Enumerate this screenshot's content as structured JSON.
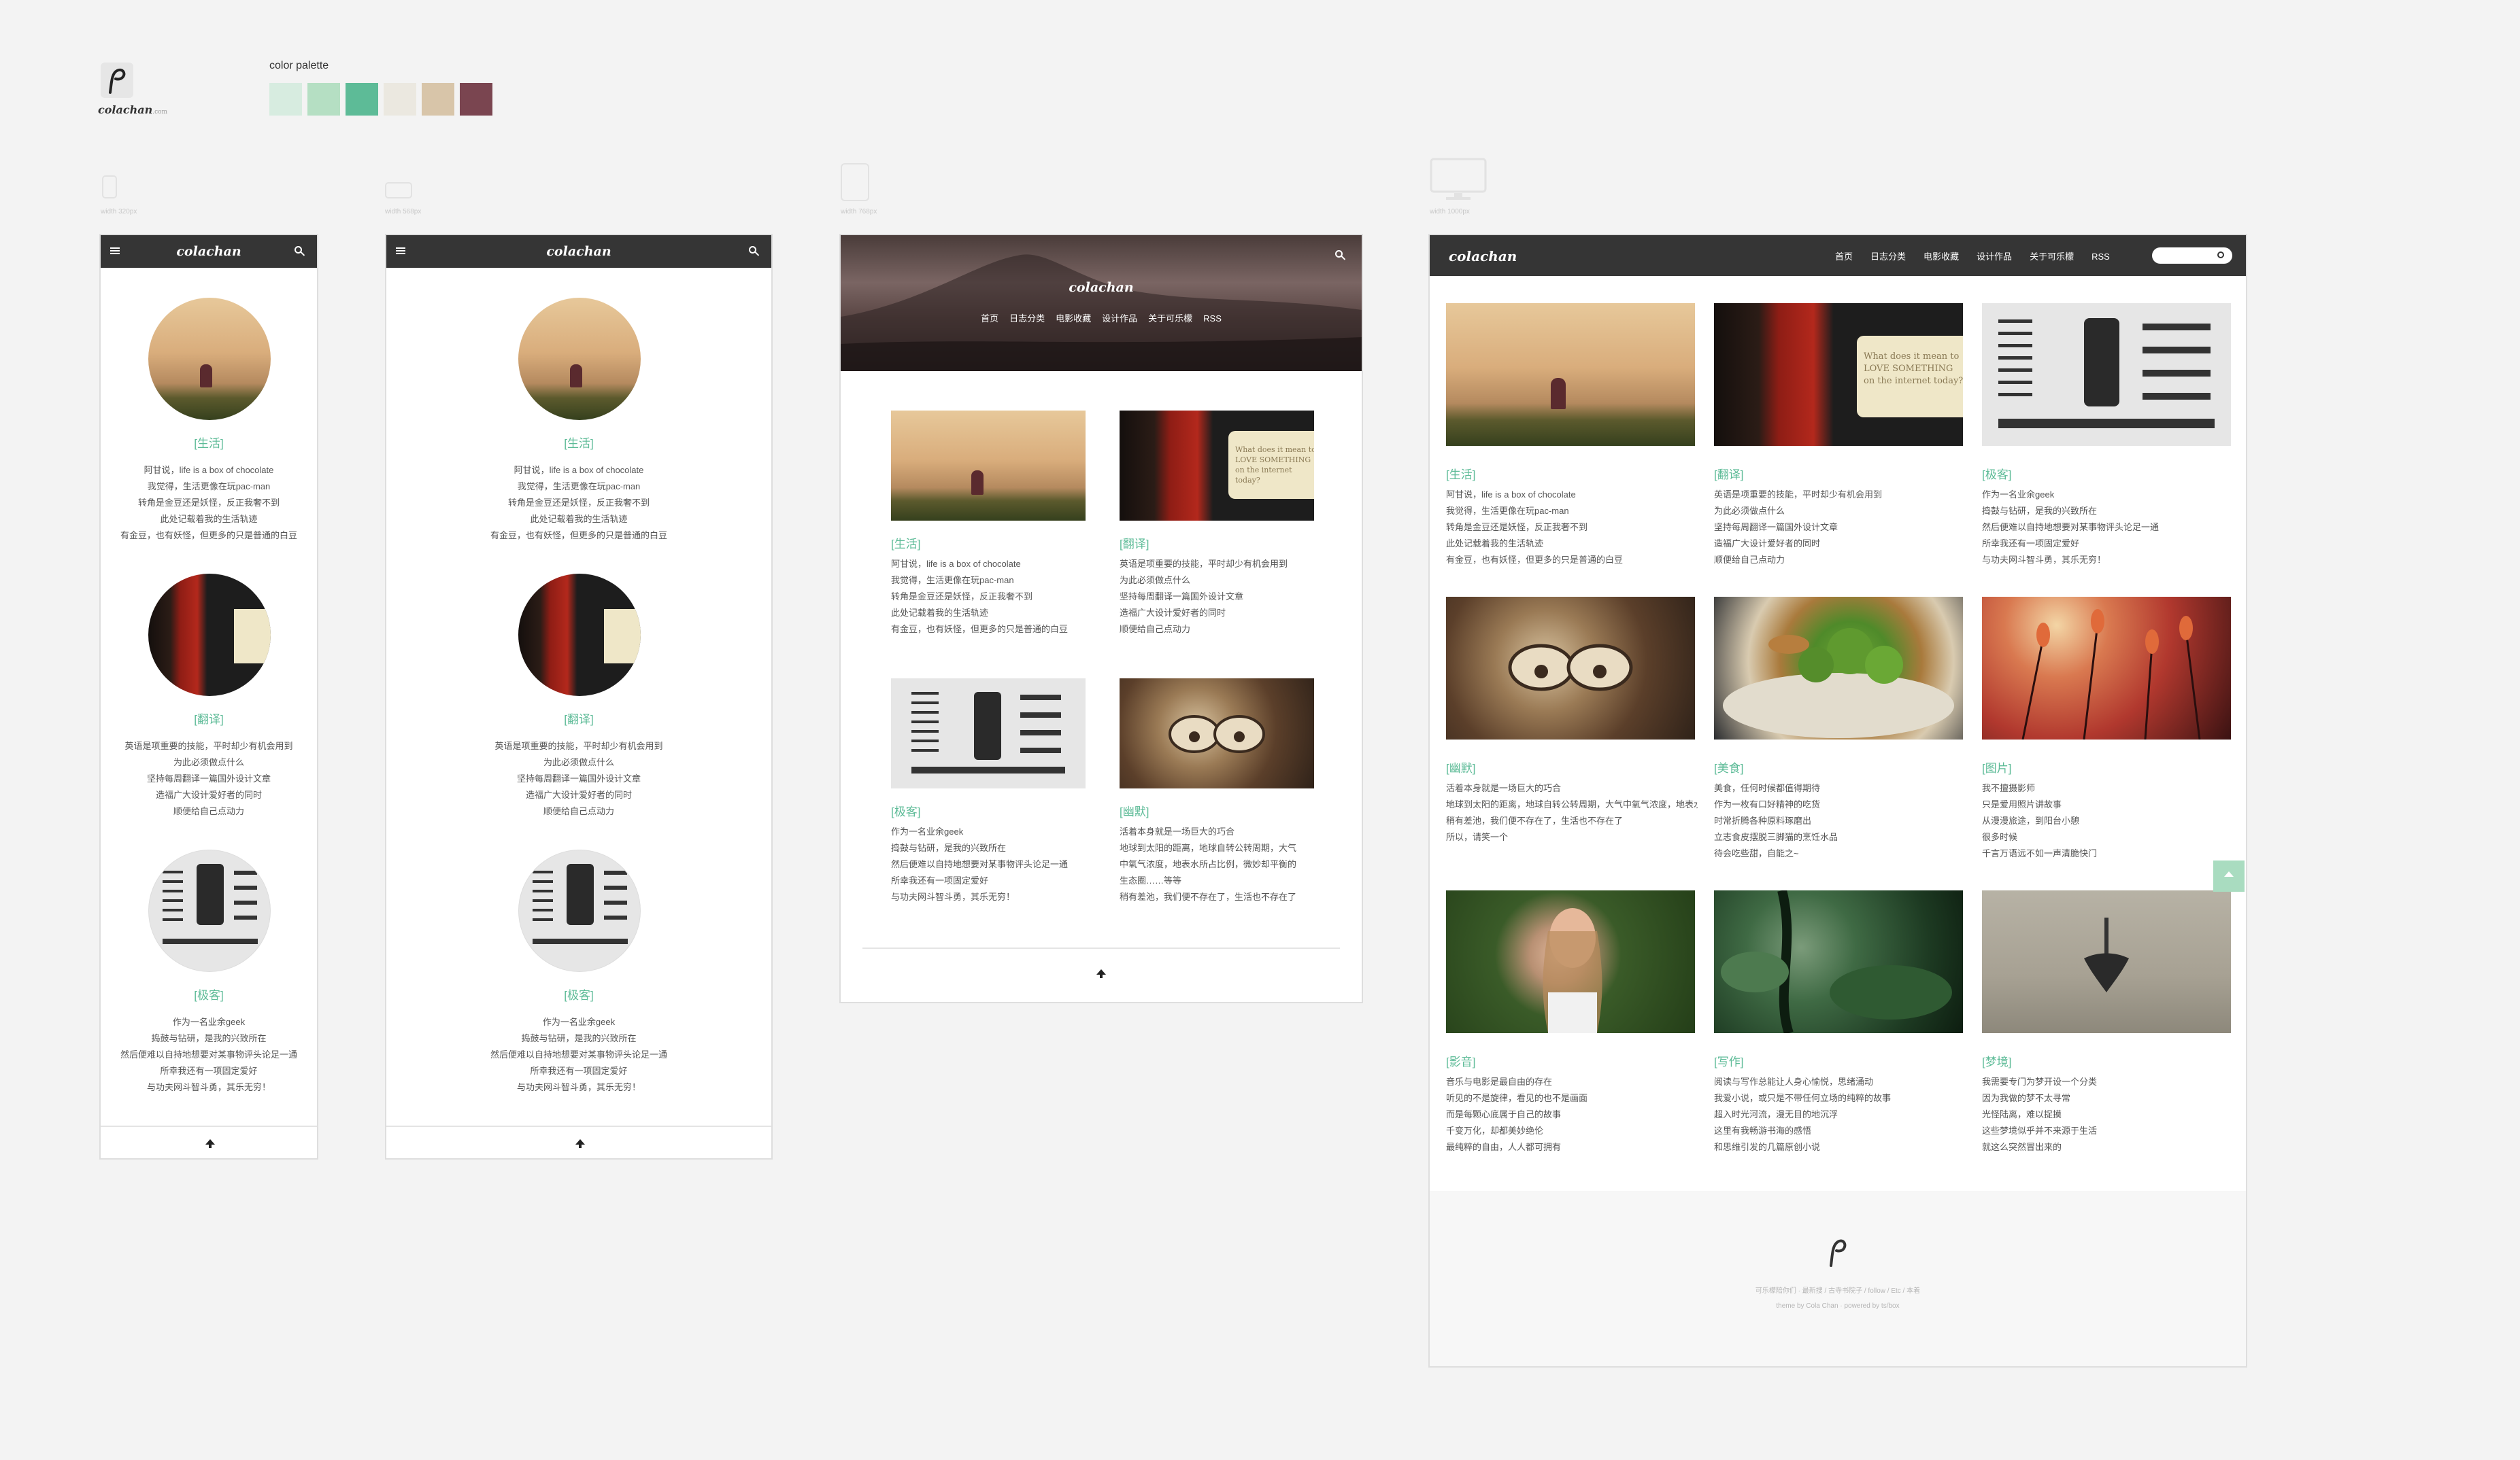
{
  "brand": {
    "name": "colachan",
    "suffix": ".com"
  },
  "palette": {
    "label": "color palette",
    "colors": [
      "#d7ece0",
      "#b5dfc3",
      "#5dbb97",
      "#ebe8e0",
      "#d8c5a9",
      "#7a4550"
    ]
  },
  "devices": [
    {
      "icon": "phone-icon",
      "label": "width 320px"
    },
    {
      "icon": "phone-landscape-icon",
      "label": "width 568px"
    },
    {
      "icon": "tablet-icon",
      "label": "width 768px"
    },
    {
      "icon": "desktop-icon",
      "label": "width 1000px"
    }
  ],
  "site": {
    "logo": "colachan",
    "nav": [
      "首页",
      "日志分类",
      "电影收藏",
      "设计作品",
      "关于可乐檬",
      "RSS"
    ],
    "posts": [
      {
        "category": "[生活]",
        "lines": [
          "阿甘说，life is a box of chocolate",
          "我觉得，生活更像在玩pac-man",
          "转角是金豆还是妖怪，反正我奢不到",
          "此处记载着我的生活轨迹",
          "有金豆，也有妖怪，但更多的只是普通的白豆"
        ]
      },
      {
        "category": "[翻译]",
        "lines": [
          "英语是项重要的技能，平时却少有机会用到",
          "为此必须做点什么",
          "坚持每周翻译一篇国外设计文章",
          "造福广大设计爱好者的同时",
          "顺便给自己点动力"
        ]
      },
      {
        "category": "[极客]",
        "lines": [
          "作为一名业余geek",
          "捣鼓与钻研，是我的兴致所在",
          "然后便难以自持地想要对某事物评头论足一通",
          "所幸我还有一项固定爱好",
          "与功夫网斗智斗勇，其乐无穷！"
        ]
      },
      {
        "category": "[幽默]",
        "lines": [
          "活着本身就是一场巨大的巧合",
          "地球到太阳的距离，地球自转公转周期，大气中氧气浓度，地表水所占比例，微妙却平衡的生态圈……等等",
          "稍有差池，我们便不存在了，生活也不存在了",
          "所以，请笑一个"
        ]
      },
      {
        "category": "[美食]",
        "lines": [
          "美食，任何时候都值得期待",
          "作为一枚有口好精神的吃货",
          "时常折腾各种原料琢磨出",
          "立志食皮摆脱三脚猫的烹饪水品",
          "待会吃些甜，自能之~"
        ]
      },
      {
        "category": "[图片]",
        "lines": [
          "我不擅摄影师",
          "只是爱用照片讲故事",
          "从漫漫旅途，到阳台小憩",
          "很多时候",
          "千言万语远不如一声清脆快门"
        ]
      },
      {
        "category": "[影音]",
        "lines": [
          "音乐与电影是最自由的存在",
          "听见的不是旋律，看见的也不是画面",
          "而是每颗心底属于自己的故事",
          "千变万化，却都美妙绝伦",
          "最纯粹的自由，人人都可拥有"
        ]
      },
      {
        "category": "[写作]",
        "lines": [
          "阅读与写作总能让人身心愉悦，思绪涌动",
          "我爱小说，或只是不带任何立场的纯粹的故事",
          "超入时光河流，漫无目的地沉浮",
          "这里有我畅游书海的感悟",
          "和思维引发的几篇原创小说"
        ]
      },
      {
        "category": "[梦境]",
        "lines": [
          "我需要专门为梦开设一个分类",
          "因为我做的梦不太寻常",
          "光怪陆离，难以捉摸",
          "这些梦境似乎并不来源于生活",
          "就这么突然冒出来的"
        ]
      }
    ],
    "tablet_lines_humor": [
      "活着本身就是一场巨大的巧合",
      "地球到太阳的距离，地球自转公转周期，大气",
      "中氧气浓度，地表水所占比例，微妙却平衡的",
      "生态圈……等等",
      "稍有差池，我们便不存在了，生活也不存在了"
    ],
    "book_text": "What does it mean to LOVE SOMETHING on the internet today?",
    "footer": {
      "links": "可乐檬陪你们 · 最新搜 / 古寺书院子 / follow / Etc / 本着",
      "credit": "theme by Cola Chan · powered by ts/box"
    }
  }
}
